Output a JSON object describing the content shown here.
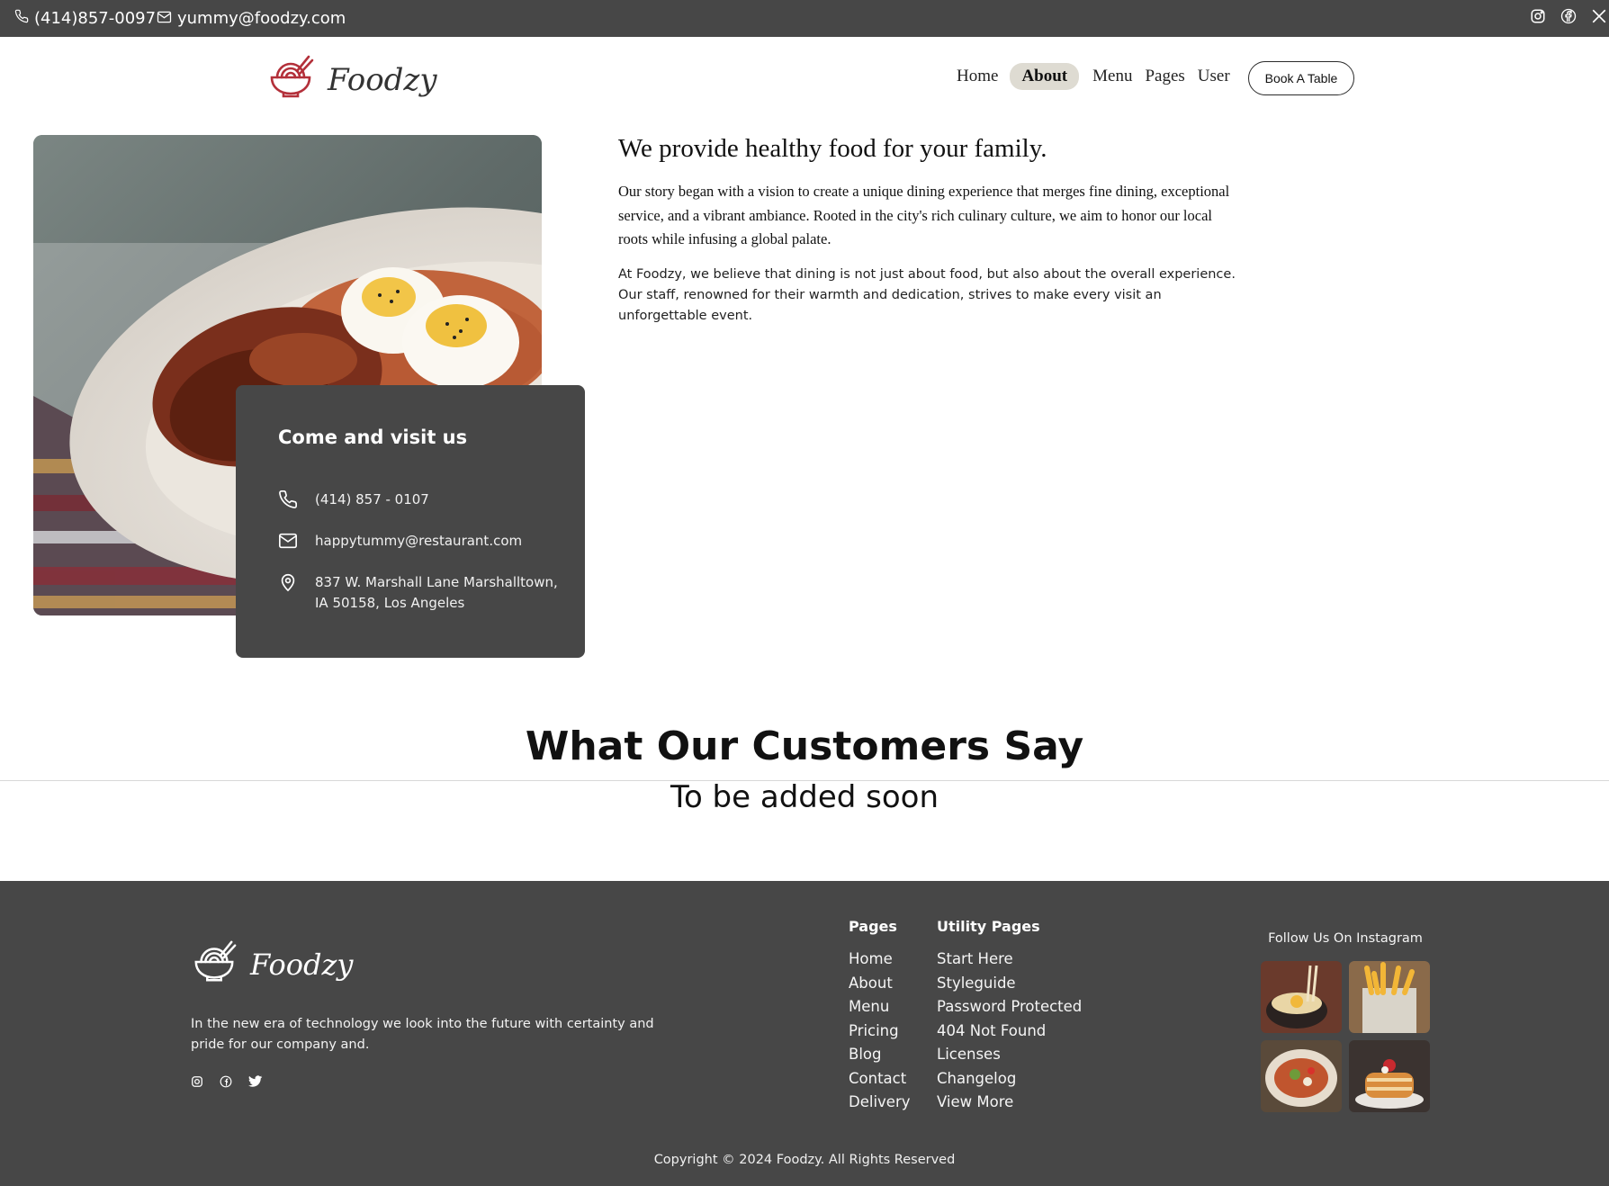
{
  "topbar": {
    "phone": "(414)857-0097",
    "email": "yummy@foodzy.com",
    "social": [
      "instagram-icon",
      "facebook-icon",
      "x-icon"
    ]
  },
  "header": {
    "brand": "Foodzy",
    "nav": [
      {
        "label": "Home",
        "active": false
      },
      {
        "label": "About",
        "active": true
      },
      {
        "label": "Menu",
        "active": false
      },
      {
        "label": "Pages",
        "active": false
      },
      {
        "label": "User",
        "active": false
      }
    ],
    "cta": "Book A Table"
  },
  "visit": {
    "title": "Come and visit us",
    "phone": "(414) 857 - 0107",
    "email": "happytummy@restaurant.com",
    "address_line1": "837 W. Marshall Lane Marshalltown,",
    "address_line2": "IA 50158, Los Angeles"
  },
  "about": {
    "title": "We provide healthy food for your family.",
    "p1": "Our story began with a vision to create a unique dining experience that merges fine dining, exceptional service, and a vibrant ambiance. Rooted in the city's rich culinary culture, we aim to honor our local roots while infusing a global palate.",
    "p2": "At Foodzy, we believe that dining is not just about food, but also about the overall experience. Our staff, renowned for their warmth and dedication, strives to make every visit an unforgettable event."
  },
  "testimonials": {
    "title": "What Our Customers Say",
    "subtitle": "To be added soon"
  },
  "footer": {
    "brand": "Foodzy",
    "description": "In the new era of technology we look into the future with certainty and pride for our company and.",
    "social": [
      "instagram-icon",
      "facebook-icon",
      "twitter-icon"
    ],
    "pages": {
      "title": "Pages",
      "links": [
        "Home",
        "About",
        "Menu",
        "Pricing",
        "Blog",
        "Contact",
        "Delivery"
      ]
    },
    "utility": {
      "title": "Utility Pages",
      "links": [
        "Start Here",
        "Styleguide",
        "Password Protected",
        "404 Not Found",
        "Licenses",
        "Changelog",
        "View More"
      ]
    },
    "instagram_title": "Follow Us On Instagram",
    "copyright": "Copyright © 2024 Foodzy. All Rights Reserved"
  },
  "colors": {
    "dark": "#474747",
    "nav_active_bg": "#dedbd2",
    "logo_red": "#b3303a"
  }
}
